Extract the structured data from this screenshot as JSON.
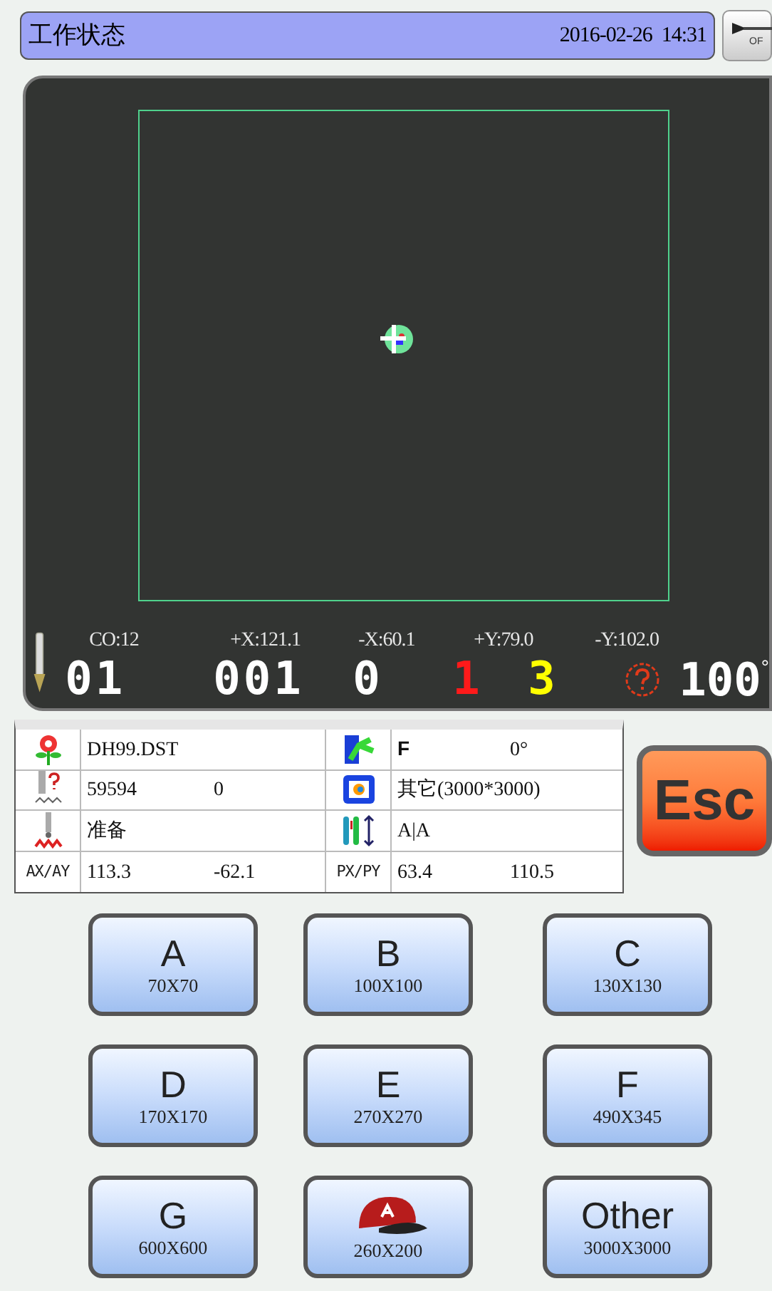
{
  "header": {
    "title": "工作状态",
    "datetime": "2016-02-26  14:31"
  },
  "off_button": {
    "label": "OF"
  },
  "canvas": {
    "readings": [
      "CO:12",
      "+X:121.1",
      "-X:60.1",
      "+Y:79.0",
      "-Y:102.0"
    ],
    "counters": [
      {
        "value": "01",
        "color": "#ffffff"
      },
      {
        "value": "001",
        "color": "#ffffff"
      },
      {
        "value": "0",
        "color": "#ffffff"
      },
      {
        "value": "1",
        "color": "#ff1a1a"
      },
      {
        "value": "3",
        "color": "#ffff00"
      }
    ],
    "speed": {
      "value": "100",
      "unit": "°"
    }
  },
  "info_rows": [
    {
      "left_values": [
        "DH99.DST"
      ],
      "right_values": [
        "F",
        "0°"
      ]
    },
    {
      "left_values": [
        "59594",
        "0"
      ],
      "right_values": [
        "其它(3000*3000)"
      ]
    },
    {
      "left_values": [
        "准备"
      ],
      "right_values": [
        "A|A"
      ]
    },
    {
      "left_label": "AX/AY",
      "left_values": [
        "113.3",
        "-62.1"
      ],
      "right_label": "PX/PY",
      "right_values": [
        "63.4",
        "110.5"
      ]
    }
  ],
  "esc_button": {
    "label": "Esc"
  },
  "frame_button_rows": [
    {
      "buttons": [
        {
          "label": "A",
          "size": "70X70"
        },
        {
          "label": "B",
          "size": "100X100"
        },
        {
          "label": "C",
          "size": "130X130"
        }
      ]
    },
    {
      "buttons": [
        {
          "label": "D",
          "size": "170X170"
        },
        {
          "label": "E",
          "size": "270X270"
        },
        {
          "label": "F",
          "size": "490X345"
        }
      ]
    },
    {
      "buttons": [
        {
          "label": "G",
          "size": "600X600"
        },
        {
          "kind": "icon",
          "size": "260X200"
        },
        {
          "label": "Other",
          "size": "3000X3000"
        }
      ]
    }
  ]
}
